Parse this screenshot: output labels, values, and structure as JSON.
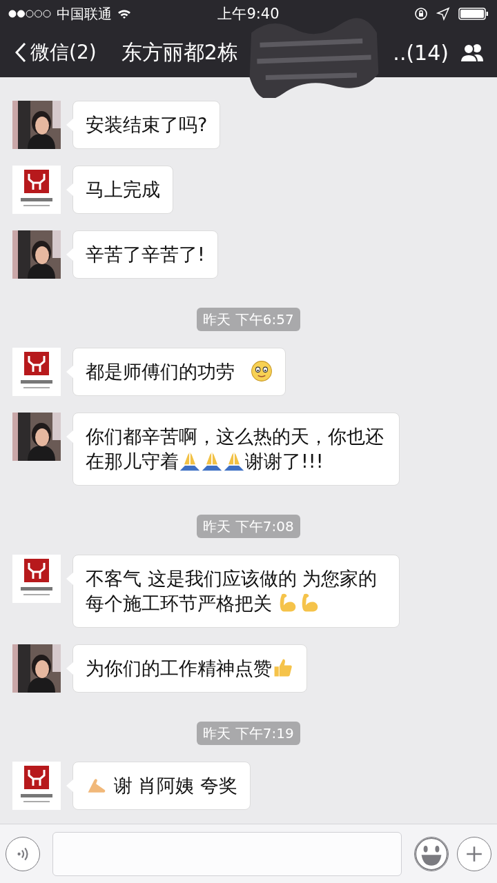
{
  "status_bar": {
    "carrier": "中国联通",
    "time": "上午9:40"
  },
  "nav": {
    "back": "微信(2)",
    "title": "东方丽都2栋",
    "member_count": "..(14)"
  },
  "chat": [
    {
      "kind": "message",
      "avatar": {
        "kind": "person"
      },
      "parts": [
        {
          "kind": "text",
          "text": "安装结束了吗?"
        }
      ]
    },
    {
      "kind": "message",
      "avatar": {
        "kind": "logo"
      },
      "parts": [
        {
          "kind": "text",
          "text": "马上完成"
        }
      ]
    },
    {
      "kind": "message",
      "avatar": {
        "kind": "person"
      },
      "parts": [
        {
          "kind": "text",
          "text": "辛苦了辛苦了!"
        }
      ]
    },
    {
      "kind": "time",
      "text": "昨天 下午6:57"
    },
    {
      "kind": "message",
      "avatar": {
        "kind": "logo"
      },
      "parts": [
        {
          "kind": "text",
          "text": "都是师傅们的功劳 "
        },
        {
          "kind": "smile"
        }
      ]
    },
    {
      "kind": "message",
      "avatar": {
        "kind": "person"
      },
      "parts": [
        {
          "kind": "text",
          "text": "你们都辛苦啊，这么热的天，你也还在那儿守着"
        },
        {
          "kind": "pray"
        },
        {
          "kind": "pray"
        },
        {
          "kind": "pray"
        },
        {
          "kind": "text",
          "text": "谢谢了!!!"
        }
      ]
    },
    {
      "kind": "time",
      "text": "昨天 下午7:08"
    },
    {
      "kind": "message",
      "avatar": {
        "kind": "logo"
      },
      "parts": [
        {
          "kind": "text",
          "text": "不客气 这是我们应该做的 为您家的每个施工环节严格把关 "
        },
        {
          "kind": "muscle"
        },
        {
          "kind": "muscle"
        }
      ]
    },
    {
      "kind": "message",
      "avatar": {
        "kind": "person"
      },
      "parts": [
        {
          "kind": "text",
          "text": "为你们的工作精神点赞"
        },
        {
          "kind": "thumb"
        }
      ]
    },
    {
      "kind": "time",
      "text": "昨天 下午7:19"
    },
    {
      "kind": "message",
      "avatar": {
        "kind": "logo"
      },
      "parts": [
        {
          "kind": "hand"
        },
        {
          "kind": "text",
          "text": " 谢 肖阿姨 夸奖"
        }
      ]
    }
  ]
}
